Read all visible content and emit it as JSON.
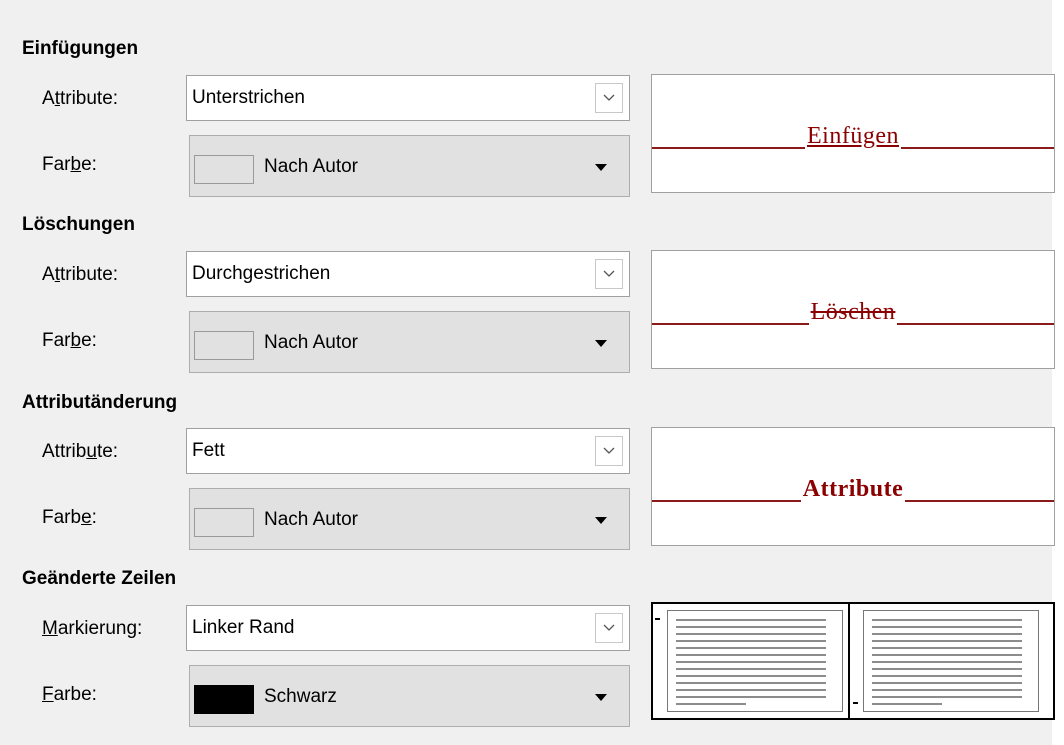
{
  "sections": {
    "insertions": {
      "title": "Einfügungen",
      "attr_label": "Attribute:",
      "attr_value": "Unterstrichen",
      "color_label": "Farbe:",
      "color_value": "Nach Autor",
      "swatch_color": "#e1e1e1",
      "preview_text": "Einfügen"
    },
    "deletions": {
      "title": "Löschungen",
      "attr_label": "Attribute:",
      "attr_value": "Durchgestrichen",
      "color_label": "Farbe:",
      "color_value": "Nach Autor",
      "swatch_color": "#e1e1e1",
      "preview_text": "Löschen"
    },
    "attribute_changes": {
      "title": "Attributänderung",
      "attr_label": "Attribute:",
      "attr_value": "Fett",
      "color_label": "Farbe:",
      "color_value": "Nach Autor",
      "swatch_color": "#e1e1e1",
      "preview_text": "Attribute"
    },
    "changed_lines": {
      "title": "Geänderte Zeilen",
      "mark_label": "Markierung:",
      "mark_value": "Linker Rand",
      "color_label": "Farbe:",
      "color_value": "Schwarz",
      "swatch_color": "#000000"
    }
  },
  "icons": {
    "combo_arrow": "chevron-down-icon",
    "dropdown_arrow": "triangle-down-icon"
  },
  "colors": {
    "preview_text": "#8b0000",
    "preview_line": "#8b1a1a",
    "panel_bg": "#f0f0f0"
  }
}
